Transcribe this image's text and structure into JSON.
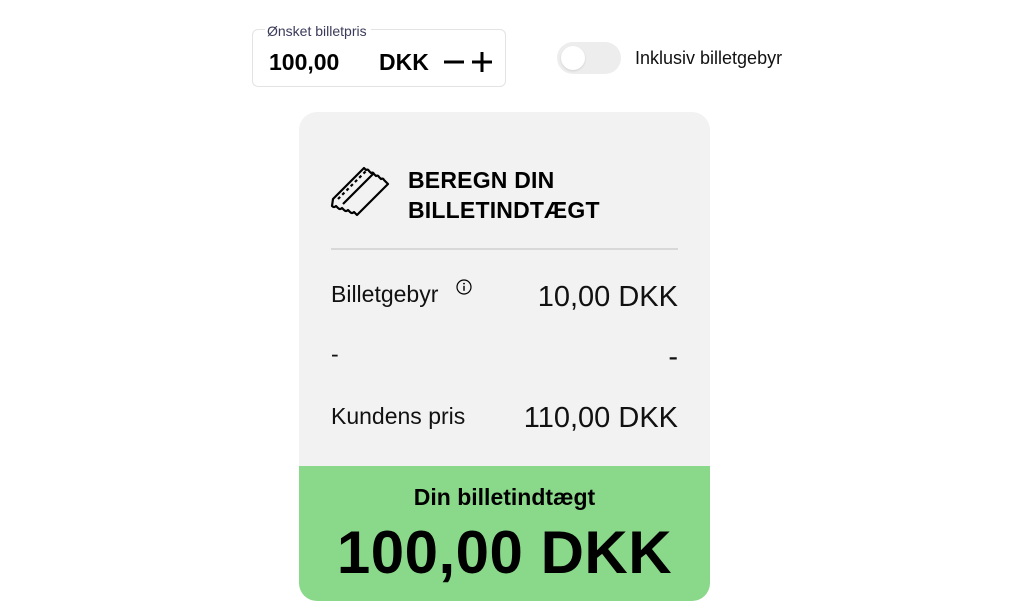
{
  "price_input": {
    "legend": "Ønsket billetpris",
    "value": "100,00",
    "currency": "DKK",
    "minus_icon": "minus-icon",
    "plus_icon": "plus-icon"
  },
  "fee_toggle": {
    "label": "Inklusiv billetgebyr",
    "checked": false
  },
  "card": {
    "icon": "ticket-icon",
    "title_line1": "BEREGN DIN",
    "title_line2": "BILLETINDTÆGT",
    "rows": [
      {
        "label": "Billetgebyr",
        "value": "10,00 DKK",
        "info_icon": "info-icon"
      },
      {
        "label": "-",
        "value": "-"
      },
      {
        "label": "Kundens pris",
        "value": "110,00 DKK"
      }
    ],
    "income": {
      "label": "Din billetindtægt",
      "value": "100,00 DKK"
    }
  },
  "colors": {
    "income_bg": "#8ad98a",
    "card_bg": "#f2f2f2",
    "toggle_off_bg": "#ededed"
  }
}
